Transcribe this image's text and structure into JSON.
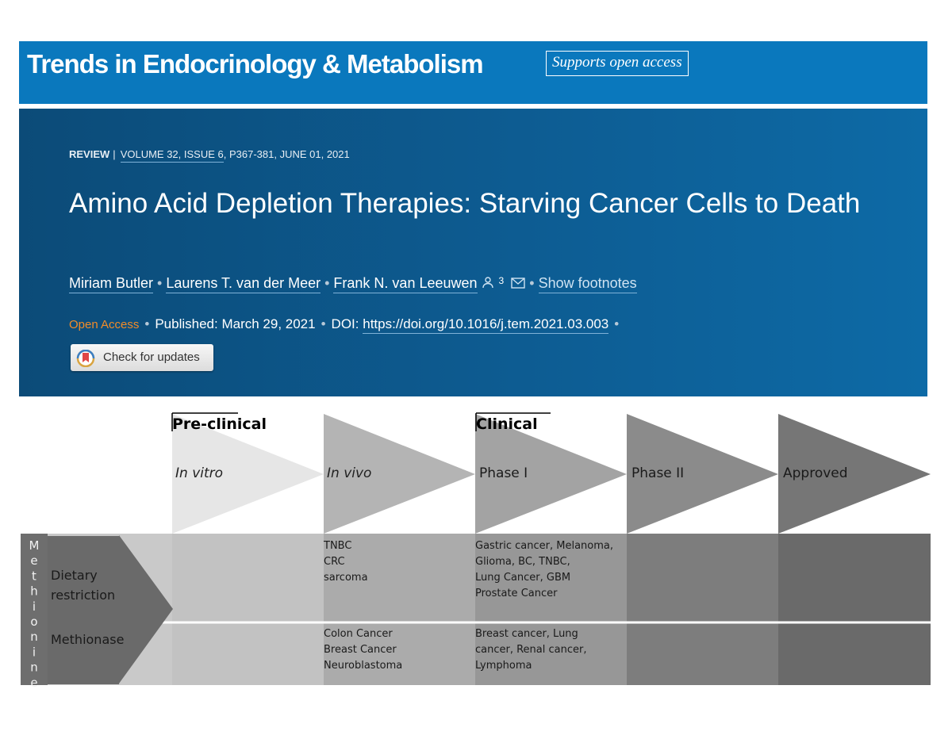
{
  "journal": {
    "name": "Trends in Endocrinology & Metabolism",
    "open_access_badge": "Supports open access"
  },
  "article": {
    "type": "REVIEW",
    "volume_issue": "VOLUME 32, ISSUE 6",
    "pages_date": ", P367-381, JUNE 01, 2021",
    "title": "Amino Acid Depletion Therapies: Starving Cancer Cells to Death",
    "authors": [
      {
        "name": "Miriam Butler"
      },
      {
        "name": "Laurens T. van der Meer"
      },
      {
        "name": "Frank N. van Leeuwen"
      }
    ],
    "contact_count": "3",
    "show_footnotes": "Show footnotes",
    "open_access": "Open Access",
    "published": "Published: March 29, 2021",
    "doi_label": "DOI:",
    "doi": "https://doi.org/10.1016/j.tem.2021.03.003",
    "check_updates": "Check for updates"
  },
  "figure": {
    "group_labels": {
      "preclinical": "Pre-clinical",
      "clinical": "Clinical"
    },
    "stages": [
      "In vitro",
      "In vivo",
      "Phase I",
      "Phase II",
      "Approved"
    ],
    "vertical_label": [
      "M",
      "e",
      "t",
      "h",
      "i",
      "o",
      "n",
      "i",
      "n",
      "e"
    ],
    "rows": [
      {
        "label": [
          "Dietary",
          "restriction"
        ],
        "cells": [
          [],
          [
            "TNBC",
            "CRC",
            "sarcoma"
          ],
          [
            "Gastric cancer, Melanoma,",
            "Glioma, BC, TNBC,",
            "Lung Cancer, GBM",
            "Prostate Cancer"
          ],
          [],
          []
        ]
      },
      {
        "label": [
          "Methionase"
        ],
        "cells": [
          [],
          [
            "Colon Cancer",
            "Breast Cancer",
            "Neuroblastoma"
          ],
          [
            "Breast cancer, Lung",
            "cancer, Renal cancer,",
            "Lymphoma"
          ],
          [],
          []
        ]
      }
    ],
    "colors": {
      "col_invitro": "#c2c2c2",
      "col_invivo": "#ababab",
      "col_phase1": "#979797",
      "col_phase2": "#7d7d7d",
      "col_approved": "#6a6a6a",
      "arrow_invitro": "#e6e6e6",
      "arrow_invivo": "#b4b4b4",
      "arrow_phase1": "#a3a3a3",
      "arrow_phase2": "#8b8b8b",
      "arrow_approved": "#767676"
    }
  }
}
